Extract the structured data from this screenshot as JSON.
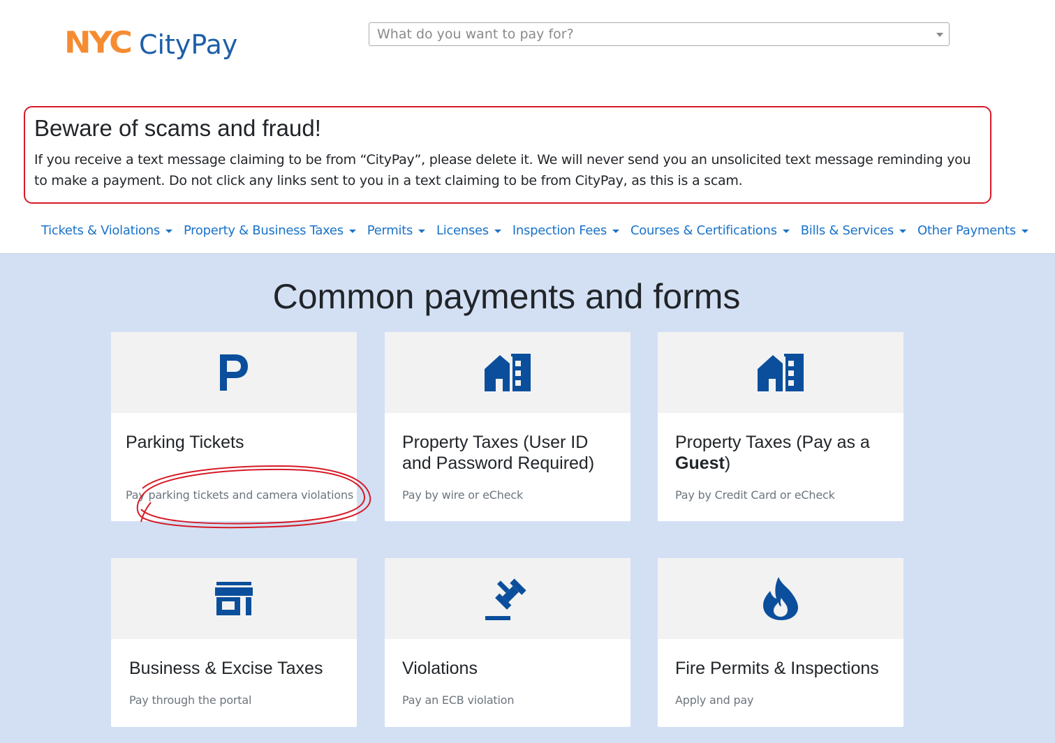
{
  "header": {
    "logo_nyc": "NYC",
    "logo_citypay": "CityPay",
    "search_placeholder": "What do you want to pay for?"
  },
  "alert": {
    "title": "Beware of scams and fraud!",
    "message": "If you receive a text message claiming to be from “CityPay”, please delete it. We will never send you an unsolicited text message reminding you to make a payment. Do not click any links sent to you in a text claiming to be from CityPay, as this is a scam."
  },
  "nav": {
    "items": [
      {
        "label": "Tickets & Violations"
      },
      {
        "label": "Property & Business Taxes"
      },
      {
        "label": "Permits"
      },
      {
        "label": "Licenses"
      },
      {
        "label": "Inspection Fees"
      },
      {
        "label": "Courses & Certifications"
      },
      {
        "label": "Bills & Services"
      },
      {
        "label": "Other Payments"
      }
    ]
  },
  "main": {
    "heading": "Common payments and forms",
    "cards": [
      {
        "icon": "parking-icon",
        "title": "Parking Tickets",
        "desc": "Pay parking tickets and camera violations"
      },
      {
        "icon": "house-icon",
        "title": "Property Taxes (User ID and Password Required)",
        "desc": "Pay by wire or eCheck"
      },
      {
        "icon": "house-icon",
        "title_pre": "Property Taxes (Pay as a ",
        "title_bold": "Guest",
        "title_post": ")",
        "desc": "Pay by Credit Card or eCheck"
      },
      {
        "icon": "storefront-icon",
        "title": "Business & Excise Taxes",
        "desc": "Pay through the portal"
      },
      {
        "icon": "gavel-icon",
        "title": "Violations",
        "desc": "Pay an ECB violation"
      },
      {
        "icon": "fire-icon",
        "title": "Fire Permits & Inspections",
        "desc": "Apply and pay"
      }
    ]
  },
  "colors": {
    "icon_blue": "#0b4f9c",
    "link_blue": "#1a73c9",
    "alert_red": "#d61a26",
    "logo_orange": "#f58c32",
    "background_blue": "#d3e0f4",
    "annotation_red": "#d61a26"
  }
}
